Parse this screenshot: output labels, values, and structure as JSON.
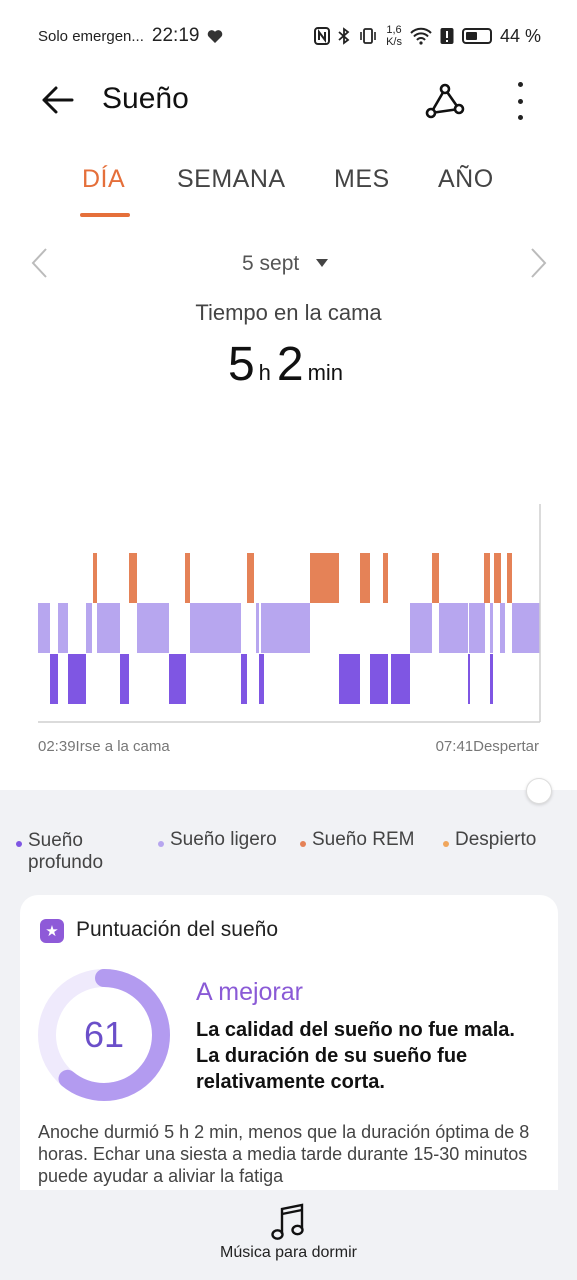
{
  "status_bar": {
    "carrier": "Solo emergen...",
    "time": "22:19",
    "speed_top": "1,6",
    "speed_bottom": "K/s",
    "battery": "44 %"
  },
  "app_bar": {
    "title": "Sueño"
  },
  "tabs": [
    {
      "label": "DÍA",
      "active": true
    },
    {
      "label": "SEMANA",
      "active": false
    },
    {
      "label": "MES",
      "active": false
    },
    {
      "label": "AÑO",
      "active": false
    }
  ],
  "date_nav": {
    "date": "5 sept"
  },
  "time_in_bed": {
    "title": "Tiempo en la cama",
    "hours": "5",
    "hours_unit": "h",
    "minutes": "2",
    "minutes_unit": "min"
  },
  "chart": {
    "start_label": "02:39Irse a la cama",
    "end_label": "07:41Despertar",
    "colors": {
      "deep": "#7f56e3",
      "light": "#b7a6ef",
      "rem": "#e58257"
    },
    "rem": [
      [
        93,
        97
      ],
      [
        129,
        137
      ],
      [
        185,
        190
      ],
      [
        247,
        254
      ],
      [
        310,
        339
      ],
      [
        360,
        370
      ],
      [
        383,
        388
      ],
      [
        432,
        439
      ],
      [
        484,
        490
      ],
      [
        494,
        501
      ],
      [
        507,
        512
      ]
    ],
    "light": [
      [
        38,
        50
      ],
      [
        58,
        68
      ],
      [
        86,
        92
      ],
      [
        97,
        120
      ],
      [
        137,
        169
      ],
      [
        190,
        241
      ],
      [
        256,
        259
      ],
      [
        261,
        310
      ],
      [
        410,
        432
      ],
      [
        439,
        468
      ],
      [
        469,
        485
      ],
      [
        490,
        493
      ],
      [
        500,
        505
      ],
      [
        512,
        540
      ]
    ],
    "deep": [
      [
        50,
        58
      ],
      [
        68,
        86
      ],
      [
        120,
        129
      ],
      [
        169,
        186
      ],
      [
        241,
        247
      ],
      [
        259,
        264
      ],
      [
        339,
        360
      ],
      [
        370,
        388
      ],
      [
        391,
        410
      ],
      [
        468,
        470
      ],
      [
        490,
        493
      ]
    ]
  },
  "legend": [
    {
      "label_line1": "Sueño",
      "label_line2": "profundo",
      "color": "#7f56e3"
    },
    {
      "label_line1": "Sueño ligero",
      "label_line2": "",
      "color": "#b7a6ef"
    },
    {
      "label_line1": "Sueño REM",
      "label_line2": "",
      "color": "#e58257"
    },
    {
      "label_line1": "Despierto",
      "label_line2": "",
      "color": "#f0a65c"
    }
  ],
  "score_card": {
    "title": "Puntuación del sueño",
    "score": "61",
    "score_fraction": 0.61,
    "verdict": "A mejorar",
    "verdict_desc": "La calidad del sueño no fue mala. La duración de su sueño fue relativamente corta.",
    "summary": "Anoche durmió 5 h 2 min, menos que la duración óptima de 8 horas. Echar una siesta a media tarde durante 15-30 minutos puede ayudar a aliviar la fatiga"
  },
  "bottom_bar": {
    "music_label": "Música para dormir"
  }
}
